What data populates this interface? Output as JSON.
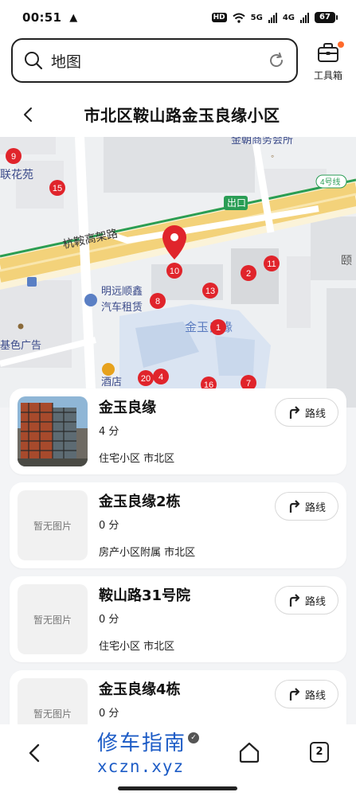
{
  "status_bar": {
    "time": "00:51",
    "warning": "▲",
    "hd": "HD",
    "net1": "5G",
    "net2": "4G",
    "battery": "67"
  },
  "search": {
    "text": "地图"
  },
  "toolbox": {
    "label": "工具箱"
  },
  "header": {
    "title": "市北区鞍山路金玉良缘小区"
  },
  "map": {
    "labels": {
      "lianhuayuan": "联花苑",
      "jinchao": "金朝商务会所",
      "hanggao": "杭鞍高架路",
      "exit": "出口",
      "exit4": "4号线",
      "mingyuan": "明远顺鑫",
      "rental": "汽车租赁",
      "jinyuliangyuan": "金玉良缘",
      "jisela": "基色广告",
      "hotel": "酒店",
      "yi": "颐"
    },
    "markers": [
      "9",
      "15",
      "10",
      "2",
      "11",
      "13",
      "8",
      "1",
      "20",
      "4",
      "16",
      "7"
    ]
  },
  "results": [
    {
      "name": "金玉良缘",
      "score": "4 分",
      "tags": "住宅小区 市北区",
      "has_photo": true,
      "no_image": "",
      "route_label": "路线"
    },
    {
      "name": "金玉良缘2栋",
      "score": "0 分",
      "tags": "房产小区附属 市北区",
      "has_photo": false,
      "no_image": "暂无图片",
      "route_label": "路线"
    },
    {
      "name": "鞍山路31号院",
      "score": "0 分",
      "tags": "住宅小区 市北区",
      "has_photo": false,
      "no_image": "暂无图片",
      "route_label": "路线"
    },
    {
      "name": "金玉良缘4栋",
      "score": "0 分",
      "tags": "",
      "has_photo": false,
      "no_image": "暂无图片",
      "route_label": "路线"
    }
  ],
  "bottom_nav": {
    "watermark_cn": "修车指南",
    "watermark_en": "xczn.xyz",
    "tab_count": "2"
  },
  "colors": {
    "marker": "#e0242b",
    "road_highlight": "#f3d27a",
    "metro_line": "#2a9d55",
    "watermark": "#1d5cc6"
  }
}
